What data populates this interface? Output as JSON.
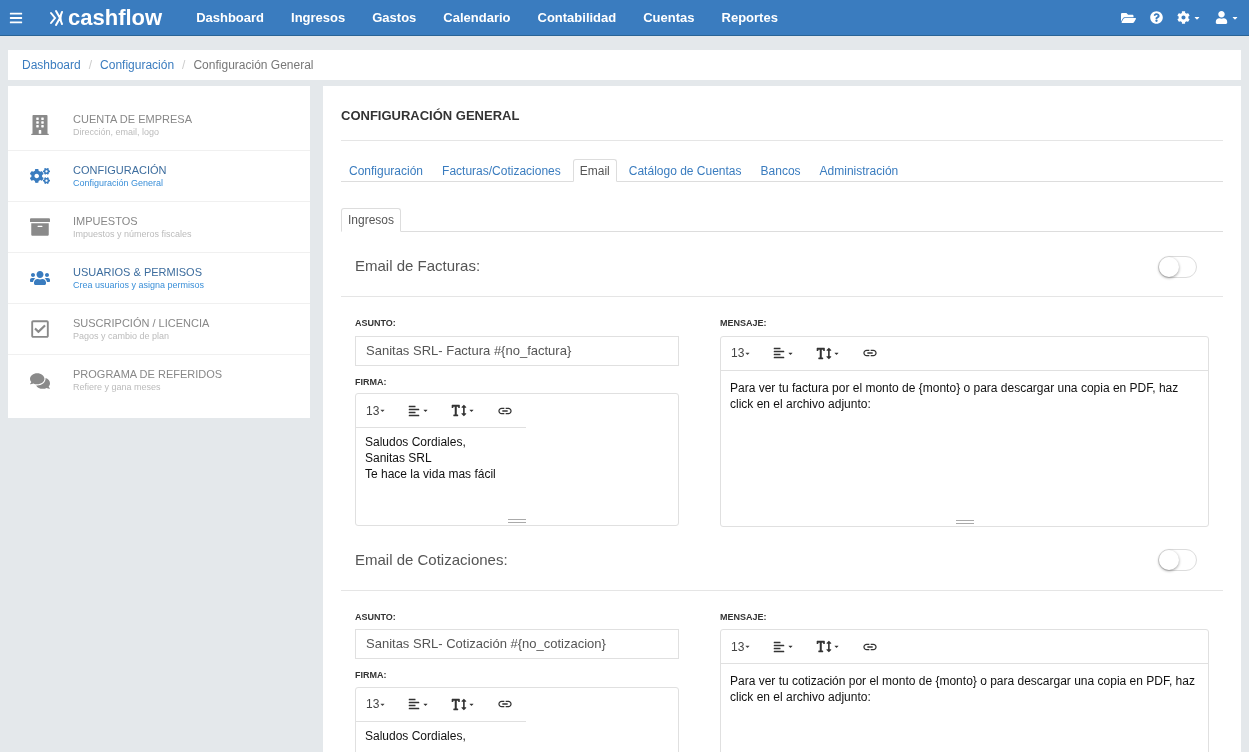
{
  "navbar": {
    "brand": "cashflow",
    "menu": [
      {
        "label": "Dashboard"
      },
      {
        "label": "Ingresos"
      },
      {
        "label": "Gastos"
      },
      {
        "label": "Calendario"
      },
      {
        "label": "Contabilidad"
      },
      {
        "label": "Cuentas"
      },
      {
        "label": "Reportes"
      }
    ]
  },
  "breadcrumb": [
    {
      "label": "Dashboard",
      "link": true
    },
    {
      "separator": "/",
      "label": "Configuración",
      "link": true
    },
    {
      "separator": "/",
      "label": "Configuración General",
      "link": false
    }
  ],
  "sidebar": {
    "items": [
      {
        "kind": "building",
        "title": "CUENTA DE EMPRESA",
        "subtitle": "Dirección, email, logo",
        "selected": false
      },
      {
        "kind": "gears",
        "title": "CONFIGURACIÓN",
        "subtitle": "Configuración General",
        "selected": true
      },
      {
        "kind": "archive",
        "title": "IMPUESTOS",
        "subtitle": "Impuestos y números fiscales",
        "selected": false
      },
      {
        "kind": "users",
        "title": "USUARIOS & PERMISOS",
        "subtitle": "Crea usuarios y asigna permisos",
        "selected": true
      },
      {
        "kind": "check",
        "title": "SUSCRIPCIÓN / LICENCIA",
        "subtitle": "Pagos y cambio de plan",
        "selected": false
      },
      {
        "kind": "chat",
        "title": "PROGRAMA DE REFERIDOS",
        "subtitle": "Refiere y gana meses",
        "selected": false
      }
    ]
  },
  "panel": {
    "title": "CONFIGURACIÓN GENERAL",
    "tabs": [
      {
        "label": "Configuración",
        "selected": false
      },
      {
        "label": "Facturas/Cotizaciones",
        "selected": false
      },
      {
        "label": "Email",
        "selected": true
      },
      {
        "label": "Catálogo de Cuentas",
        "selected": false
      },
      {
        "label": "Bancos",
        "selected": false
      },
      {
        "label": "Administración",
        "selected": false
      }
    ],
    "subtabs": [
      {
        "label": "Ingresos",
        "selected": true
      }
    ],
    "sections": [
      {
        "title": "Email de Facturas:",
        "enabled": false,
        "subject_label": "ASUNTO:",
        "subject": "Sanitas SRL- Factura #{no_factura}",
        "signature_label": "FIRMA:",
        "signature": {
          "font_size": "13",
          "lines": [
            "Saludos Cordiales,",
            "Sanitas SRL",
            "Te hace la vida mas fácil"
          ]
        },
        "message_label": "MENSAJE:",
        "message": {
          "font_size": "13",
          "text": "Para ver tu factura por el monto de {monto} o para descargar una copia en PDF, haz click en el archivo adjunto:"
        }
      },
      {
        "title": "Email de Cotizaciones:",
        "enabled": false,
        "subject_label": "ASUNTO:",
        "subject": "Sanitas SRL- Cotización  #{no_cotizacion}",
        "signature_label": "FIRMA:",
        "signature": {
          "font_size": "13",
          "lines": [
            "Saludos Cordiales,"
          ]
        },
        "message_label": "MENSAJE:",
        "message": {
          "font_size": "13",
          "text": "Para ver tu cotización por el monto de {monto} o para descargar una copia en PDF, haz click en el archivo adjunto:"
        }
      }
    ]
  }
}
